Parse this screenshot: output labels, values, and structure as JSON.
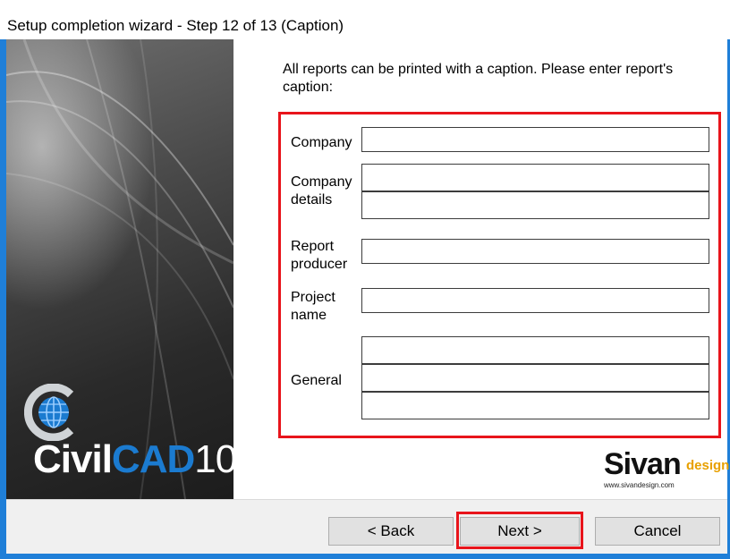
{
  "window": {
    "title": "Setup completion wizard - Step 12 of 13  (Caption)"
  },
  "branding": {
    "product_civil": "Civil",
    "product_cad": "CAD",
    "product_version": "10",
    "company_main": "Sivan",
    "company_suffix": "design",
    "company_url": "www.sivandesign.com",
    "accent_color": "#1b7bd0",
    "highlight_color": "#e8141b"
  },
  "content": {
    "instruction": "All reports can be printed with a caption. Please enter report's caption:",
    "labels": {
      "company": "Company",
      "company_details": "Company details",
      "report_producer": "Report producer",
      "project_name": "Project name",
      "general": "General"
    },
    "values": {
      "company": "",
      "company_details_1": "",
      "company_details_2": "",
      "report_producer": "",
      "project_name": "",
      "general_1": "",
      "general_2": "",
      "general_3": ""
    }
  },
  "buttons": {
    "back": "< Back",
    "next": "Next >",
    "cancel": "Cancel"
  }
}
